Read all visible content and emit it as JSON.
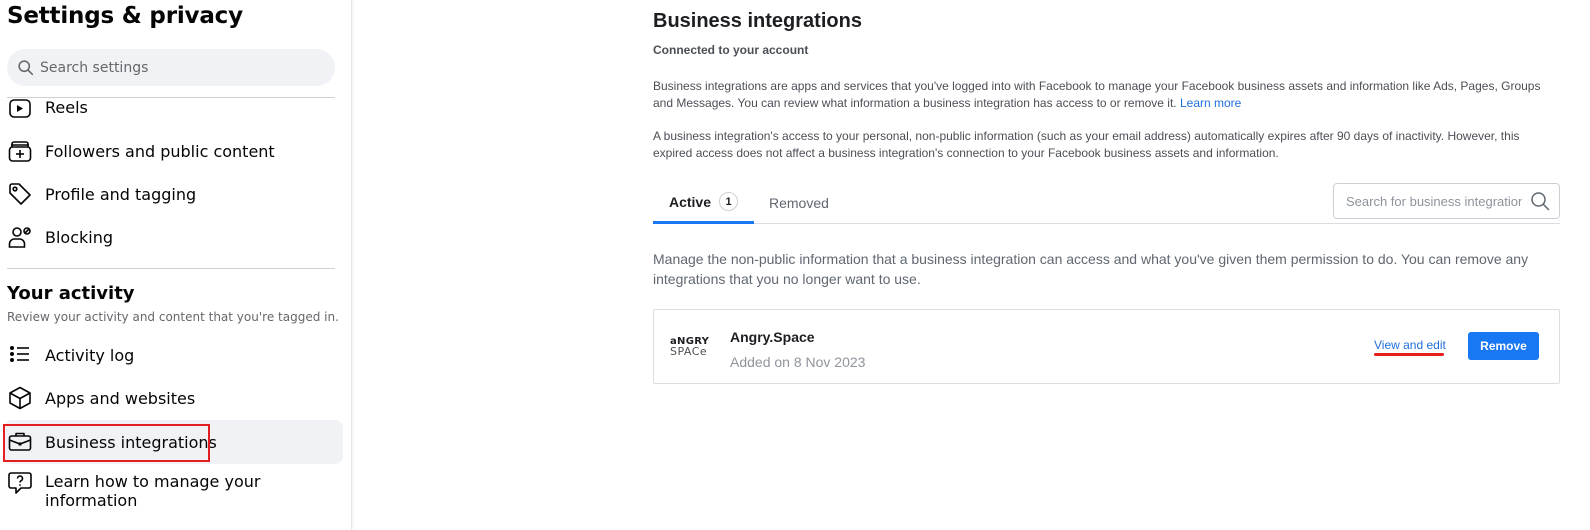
{
  "sidebar": {
    "title": "Settings & privacy",
    "search_placeholder": "Search settings",
    "items_top": [
      {
        "label": "Reels",
        "icon": "reels-icon"
      },
      {
        "label": "Followers and public content",
        "icon": "followers-icon"
      },
      {
        "label": "Profile and tagging",
        "icon": "tag-icon"
      },
      {
        "label": "Blocking",
        "icon": "block-user-icon"
      }
    ],
    "section": {
      "title": "Your activity",
      "subtitle": "Review your activity and content that you're tagged in."
    },
    "items_activity": [
      {
        "label": "Activity log",
        "icon": "list-icon"
      },
      {
        "label": "Apps and websites",
        "icon": "cube-icon"
      },
      {
        "label": "Business integrations",
        "icon": "briefcase-icon",
        "active": true
      },
      {
        "label": "Learn how to manage your information",
        "icon": "help-bubble-icon"
      }
    ]
  },
  "main": {
    "title": "Business integrations",
    "subtitle": "Connected to your account",
    "paragraph1": "Business integrations are apps and services that you've logged into with Facebook to manage your Facebook business assets and information like Ads, Pages, Groups and Messages. You can review what information a business integration has access to or remove it.",
    "learn_more": "Learn more",
    "paragraph2": "A business integration's access to your personal, non-public information (such as your email address) automatically expires after 90 days of inactivity. However, this expired access does not affect a business integration's connection to your Facebook business assets and information.",
    "tabs": [
      {
        "label": "Active",
        "count": "1",
        "active": true
      },
      {
        "label": "Removed",
        "active": false
      }
    ],
    "search_placeholder": "Search for business integrations",
    "manage_text": "Manage the non-public information that a business integration can access and what you've given them permission to do. You can remove any integrations that you no longer want to use.",
    "integrations": [
      {
        "logo_line1": "aNGRY",
        "logo_line2": "SPACe",
        "name": "Angry.Space",
        "added": "Added on 8 Nov 2023",
        "view_edit_label": "View and edit",
        "remove_label": "Remove"
      }
    ]
  },
  "colors": {
    "accent": "#1877f2",
    "link": "#216fdb",
    "highlight": "#e41e1e",
    "active_bg": "#f0f2f5"
  }
}
